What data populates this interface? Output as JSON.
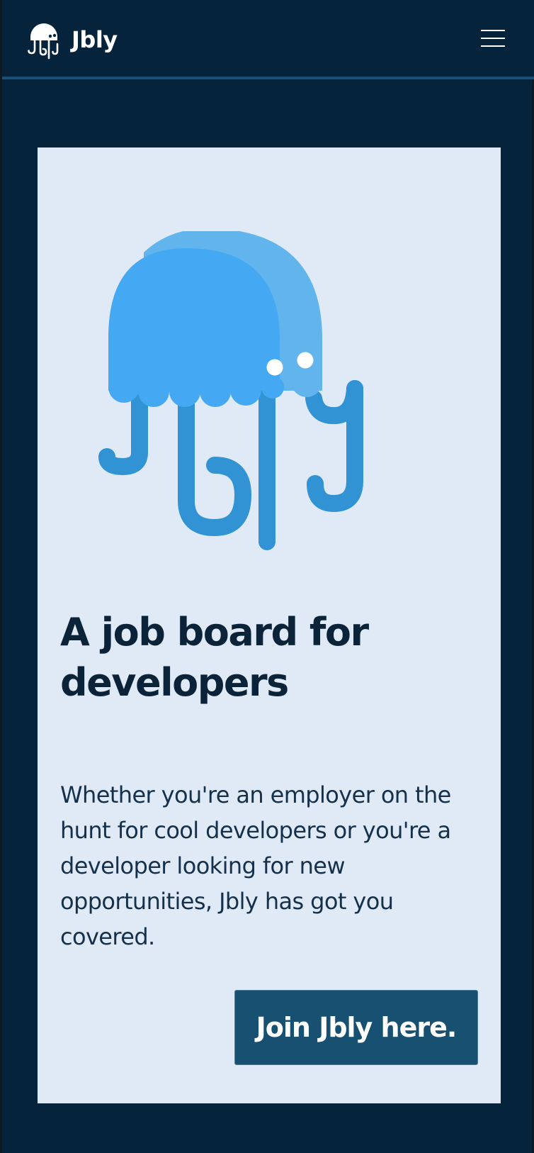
{
  "navbar": {
    "brand_name": "Jbly",
    "logo_icon": "jellyfish-logo-icon",
    "menu_icon": "hamburger-menu-icon"
  },
  "hero": {
    "illustration_icon": "jellyfish-mascot-illustration",
    "headline": "A job board for developers",
    "description": "Whether you're an employer on the hunt for cool developers or you're a developer looking for new opportunities, Jbly has got you covered.",
    "cta_label": "Join Jbly here."
  },
  "colors": {
    "page_background": "#05233a",
    "navbar_border": "#1b4f78",
    "card_background": "#dfeaf6",
    "mascot_light": "#62b5ec",
    "mascot_main": "#45a8f2",
    "mascot_tentacles": "#3193d3",
    "headline_text": "#0a2338",
    "cta_background": "#185072",
    "cta_text": "#ffffff"
  }
}
